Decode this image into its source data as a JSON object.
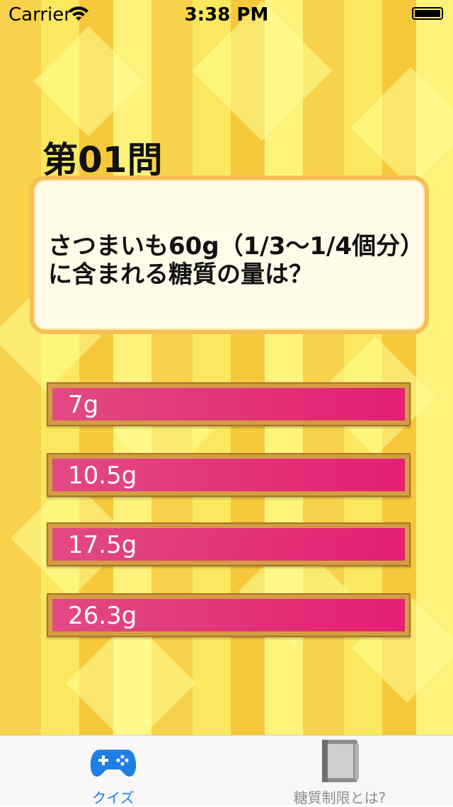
{
  "status_bar": {
    "carrier": "Carrier",
    "time": "3:38 PM"
  },
  "quiz": {
    "question_number": "第01問",
    "question_text": "さつまいも60g（1/3〜1/4個分）に含まれる糖質の量は？",
    "answers": [
      {
        "label": "7g"
      },
      {
        "label": "10.5g"
      },
      {
        "label": "17.5g"
      },
      {
        "label": "26.3g"
      }
    ]
  },
  "tab_bar": {
    "tabs": [
      {
        "label": "クイズ",
        "icon": "gamepad-icon",
        "active": true,
        "color": "#1e7fe6"
      },
      {
        "label": "糖質制限とは?",
        "icon": "book-icon",
        "active": false,
        "color": "#8e8e8e"
      }
    ]
  },
  "colors": {
    "answer_pink": "#e41f72",
    "answer_frame": "#d49d43",
    "question_border": "#f4bf55",
    "background_yellow": "#fbe85e"
  }
}
